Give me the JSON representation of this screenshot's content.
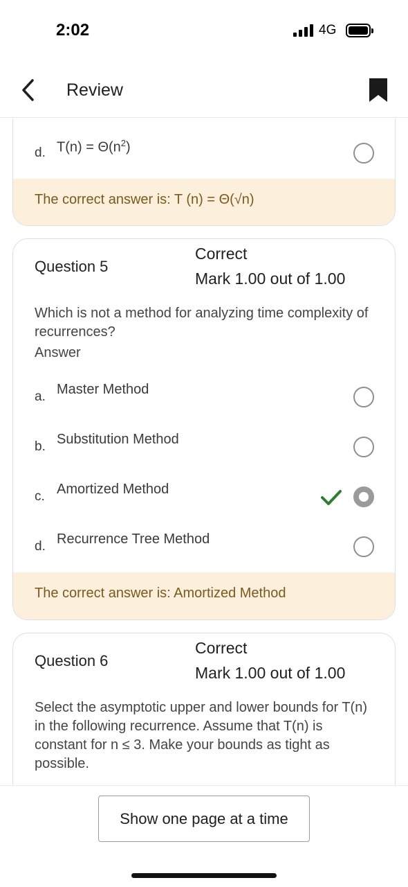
{
  "status_bar": {
    "time": "2:02",
    "network": "4G"
  },
  "nav": {
    "title": "Review",
    "back_icon": "chevron-left-icon",
    "bookmark_icon": "bookmark-icon"
  },
  "question4_tail": {
    "option_d": {
      "letter": "d.",
      "text_prefix": "T(n) = Θ(n",
      "text_sup": "2",
      "text_suffix": ")"
    },
    "feedback": "The correct answer is: T (n) = Θ(√n)"
  },
  "question5": {
    "title": "Question 5",
    "status": "Correct",
    "mark": "Mark 1.00 out of 1.00",
    "text": "Which is not a method for analyzing time complexity of recurrences?",
    "answer_label": "Answer",
    "options": [
      {
        "letter": "a.",
        "text": "Master Method"
      },
      {
        "letter": "b.",
        "text": "Substitution Method"
      },
      {
        "letter": "c.",
        "text": "Amortized Method"
      },
      {
        "letter": "d.",
        "text": "Recurrence Tree Method"
      }
    ],
    "selected_option": "c.",
    "feedback": "The correct answer is: Amortized Method"
  },
  "question6": {
    "title": "Question 6",
    "status": "Correct",
    "mark": "Mark 1.00 out of 1.00",
    "text": "Select the asymptotic upper and lower bounds for T(n) in the following recurrence. Assume that T(n) is constant for n ≤ 3.  Make your bounds as tight as possible."
  },
  "footer": {
    "button_label": "Show one page at a time"
  },
  "colors": {
    "feedback_bg": "#fcefdb",
    "feedback_text": "#7a5a1e",
    "check_green": "#2e7d32",
    "radio_border": "#8f8f8f"
  }
}
